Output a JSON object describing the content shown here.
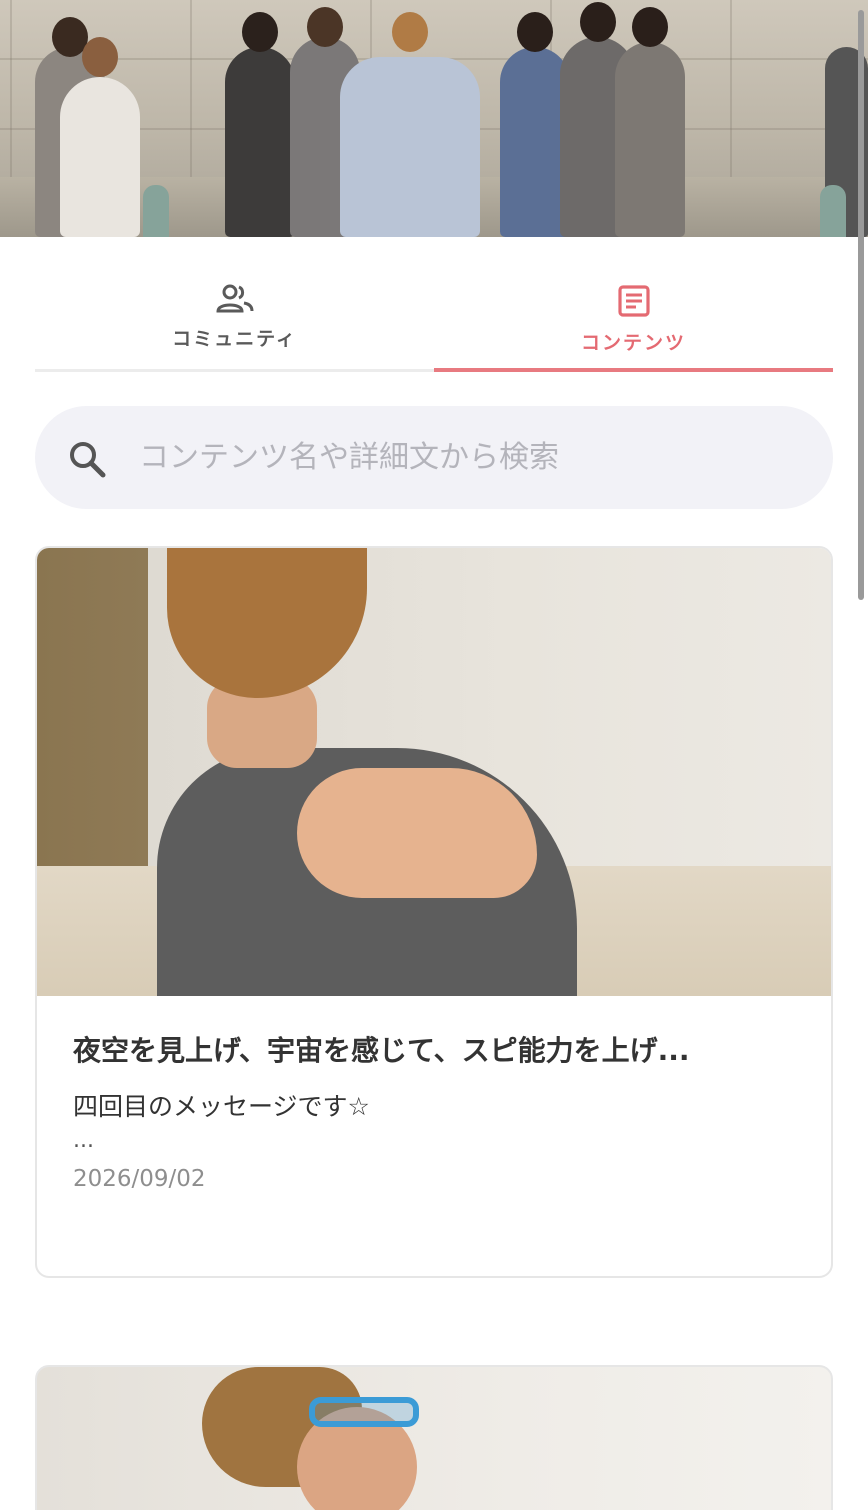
{
  "tabs": [
    {
      "label": "コミュニティ",
      "icon": "people-icon",
      "selected": false
    },
    {
      "label": "コンテンツ",
      "icon": "article-icon",
      "selected": true
    }
  ],
  "search": {
    "placeholder": "コンテンツ名や詳細文から検索",
    "value": ""
  },
  "contents": [
    {
      "title": "夜空を見上げ、宇宙を感じて、スピ能力を上げ...",
      "description": "四回目のメッセージです☆",
      "more": "...",
      "date": "2026/09/02"
    }
  ],
  "colors": {
    "accent": "#e46a72",
    "tab_inactive": "#5a5a5a",
    "search_bg": "#f2f2f7"
  }
}
